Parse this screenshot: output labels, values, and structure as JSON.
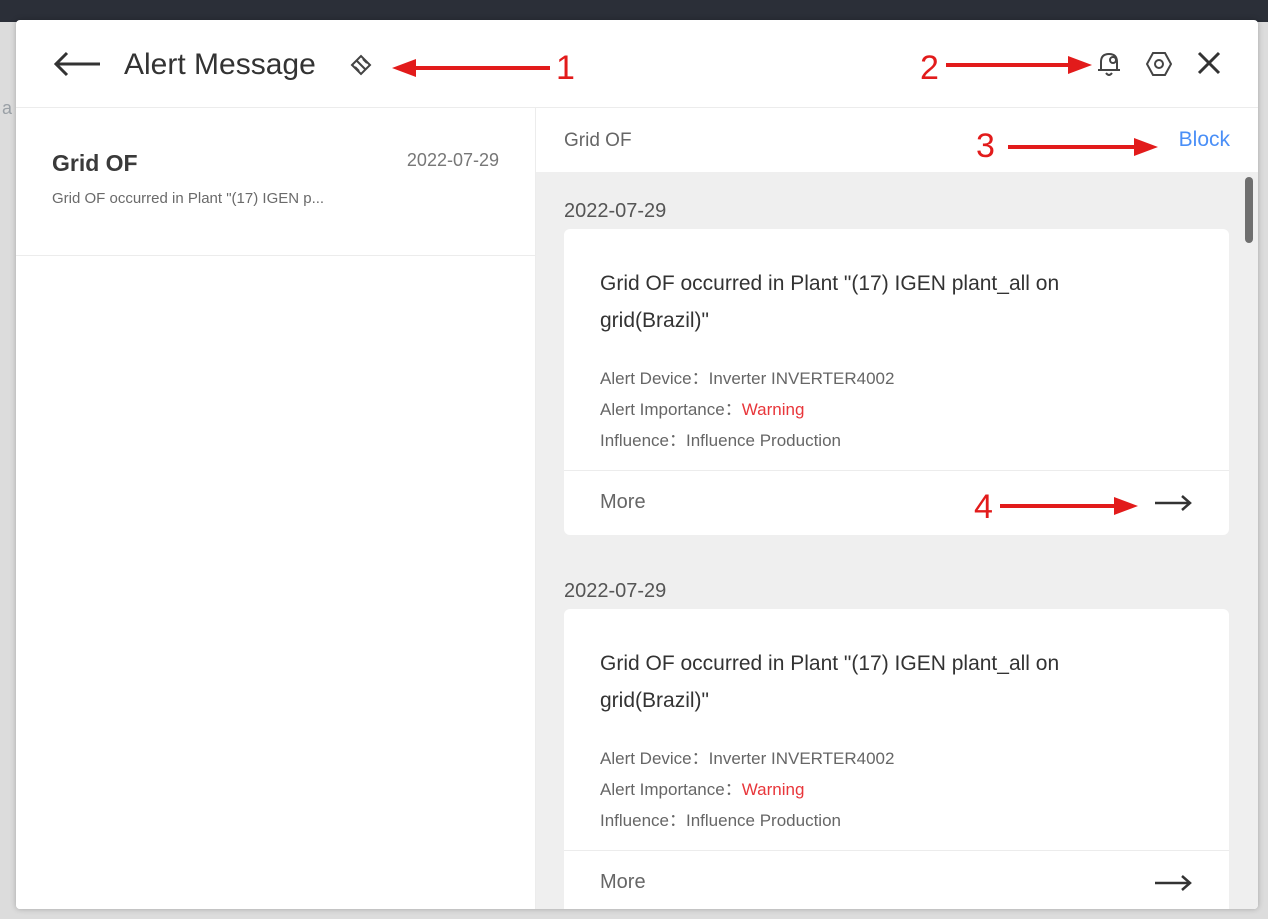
{
  "header": {
    "title": "Alert Message"
  },
  "list": {
    "items": [
      {
        "title": "Grid OF",
        "date": "2022-07-29",
        "description": "Grid OF occurred in Plant \"(17) IGEN p..."
      }
    ]
  },
  "detail": {
    "title": "Grid OF",
    "block_label": "Block",
    "cards": [
      {
        "date": "2022-07-29",
        "message": "Grid OF occurred in Plant \"(17) IGEN plant_all on grid(Brazil)\"",
        "device_label": "Alert Device：",
        "device_value": "Inverter INVERTER4002",
        "importance_label": "Alert Importance：",
        "importance_value": "Warning",
        "influence_label": "Influence：",
        "influence_value": "Influence Production",
        "more_label": "More"
      },
      {
        "date": "2022-07-29",
        "message": "Grid OF occurred in Plant \"(17) IGEN plant_all on grid(Brazil)\"",
        "device_label": "Alert Device：",
        "device_value": "Inverter INVERTER4002",
        "importance_label": "Alert Importance：",
        "importance_value": "Warning",
        "influence_label": "Influence：",
        "influence_value": "Influence Production",
        "more_label": "More"
      }
    ]
  },
  "annotations": {
    "n1": "1",
    "n2": "2",
    "n3": "3",
    "n4": "4"
  },
  "background": {
    "hint": "a"
  },
  "icons": {
    "back": "arrow-left-icon",
    "mark_read": "broom-icon",
    "bell": "bell-settings-icon",
    "settings": "gear-icon",
    "close": "close-icon",
    "more": "arrow-right-icon"
  },
  "colors": {
    "link": "#4a8ff7",
    "warning": "#e8363a",
    "annotation": "#e21b1b"
  }
}
